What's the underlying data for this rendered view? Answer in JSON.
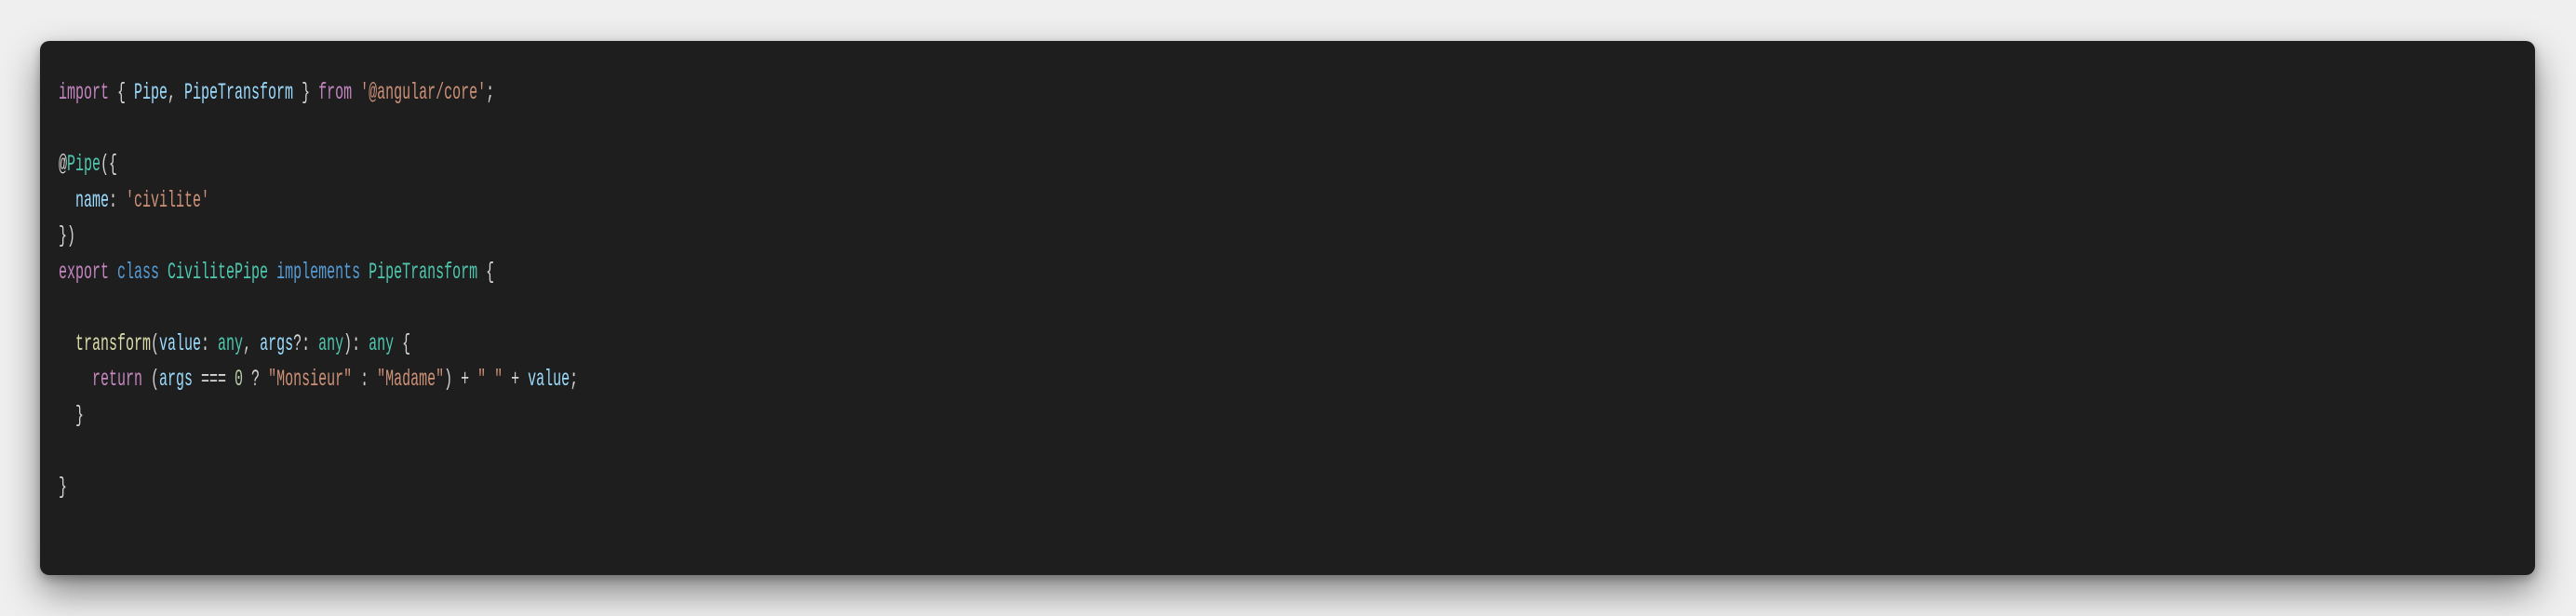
{
  "code": {
    "language": "typescript",
    "lines": [
      [
        [
          "kw",
          "import"
        ],
        [
          "brace",
          " { "
        ],
        [
          "id",
          "Pipe"
        ],
        [
          "brace",
          ", "
        ],
        [
          "id",
          "PipeTransform"
        ],
        [
          "brace",
          " } "
        ],
        [
          "kw",
          "from"
        ],
        [
          "brace",
          " "
        ],
        [
          "str",
          "'@angular/core'"
        ],
        [
          "brace",
          ";"
        ]
      ],
      [],
      [
        [
          "brace",
          "@"
        ],
        [
          "cls",
          "Pipe"
        ],
        [
          "brace",
          "({"
        ]
      ],
      [
        [
          "brace",
          "  "
        ],
        [
          "id",
          "name"
        ],
        [
          "brace",
          ": "
        ],
        [
          "str",
          "'civilite'"
        ]
      ],
      [
        [
          "brace",
          "})"
        ]
      ],
      [
        [
          "kw",
          "export"
        ],
        [
          "brace",
          " "
        ],
        [
          "kw2",
          "class"
        ],
        [
          "brace",
          " "
        ],
        [
          "cls",
          "CivilitePipe"
        ],
        [
          "brace",
          " "
        ],
        [
          "kw2",
          "implements"
        ],
        [
          "brace",
          " "
        ],
        [
          "cls",
          "PipeTransform"
        ],
        [
          "brace",
          " {"
        ]
      ],
      [],
      [
        [
          "brace",
          "  "
        ],
        [
          "fn",
          "transform"
        ],
        [
          "brace",
          "("
        ],
        [
          "id",
          "value"
        ],
        [
          "brace",
          ": "
        ],
        [
          "cls",
          "any"
        ],
        [
          "brace",
          ", "
        ],
        [
          "id",
          "args"
        ],
        [
          "brace",
          "?: "
        ],
        [
          "cls",
          "any"
        ],
        [
          "brace",
          "): "
        ],
        [
          "cls",
          "any"
        ],
        [
          "brace",
          " {"
        ]
      ],
      [
        [
          "brace",
          "    "
        ],
        [
          "kw",
          "return"
        ],
        [
          "brace",
          " ("
        ],
        [
          "id",
          "args"
        ],
        [
          "brace",
          " === "
        ],
        [
          "num",
          "0"
        ],
        [
          "brace",
          " ? "
        ],
        [
          "str",
          "\"Monsieur\""
        ],
        [
          "brace",
          " : "
        ],
        [
          "str",
          "\"Madame\""
        ],
        [
          "brace",
          ") + "
        ],
        [
          "str",
          "\" \""
        ],
        [
          "brace",
          " + "
        ],
        [
          "id",
          "value"
        ],
        [
          "brace",
          ";"
        ]
      ],
      [
        [
          "brace",
          "  }"
        ]
      ],
      [],
      [
        [
          "brace",
          "}"
        ]
      ]
    ]
  }
}
